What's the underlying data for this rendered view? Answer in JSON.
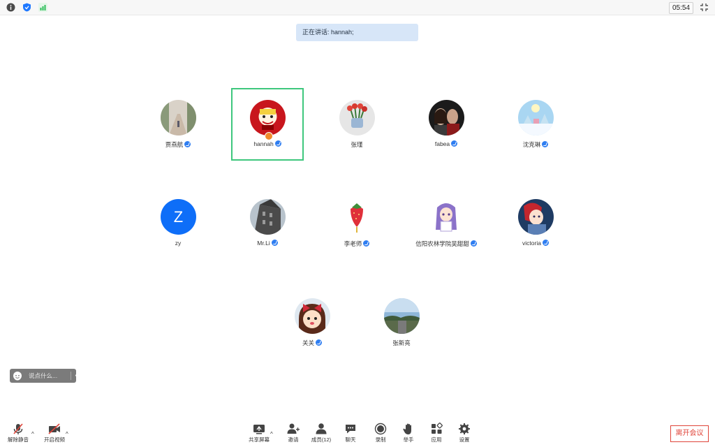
{
  "topbar": {
    "timer": "05:54",
    "colors": {
      "info": "#4a4a4a",
      "shield": "#1e78ff",
      "signal": "#2dbe5a"
    }
  },
  "speaking": {
    "text": "正在讲话: hannah;"
  },
  "participants": [
    {
      "name": "贾燕航",
      "verified": true,
      "avatar": "photo-trees"
    },
    {
      "name": "hannah",
      "verified": true,
      "avatar": "cartoon-red",
      "active": true,
      "host": true
    },
    {
      "name": "张瑾",
      "verified": false,
      "avatar": "photo-flowers"
    },
    {
      "name": "fabea",
      "verified": true,
      "avatar": "photo-dark"
    },
    {
      "name": "沈克琳",
      "verified": true,
      "avatar": "photo-snow"
    },
    {
      "name": "zy",
      "verified": false,
      "avatar": "letter",
      "letter": "Z"
    },
    {
      "name": "Mr.Li",
      "verified": true,
      "avatar": "photo-building"
    },
    {
      "name": "李老师",
      "verified": true,
      "avatar": "strawberry"
    },
    {
      "name": "信阳农林学院吴甜甜",
      "verified": true,
      "avatar": "anime-purple"
    },
    {
      "name": "victoria",
      "verified": true,
      "avatar": "anime-red"
    },
    {
      "name": "关关",
      "verified": true,
      "avatar": "cartoon-girl"
    },
    {
      "name": "张新亮",
      "verified": false,
      "avatar": "photo-sky"
    }
  ],
  "chat": {
    "placeholder": "说点什么..."
  },
  "toolbar": {
    "unmute": "解除静音",
    "video": "开启视频",
    "share": "共享屏幕",
    "invite": "邀请",
    "members": "成员(12)",
    "chat": "聊天",
    "record": "录制",
    "raise_hand": "举手",
    "apps": "应用",
    "settings": "设置",
    "leave": "离开会议"
  }
}
